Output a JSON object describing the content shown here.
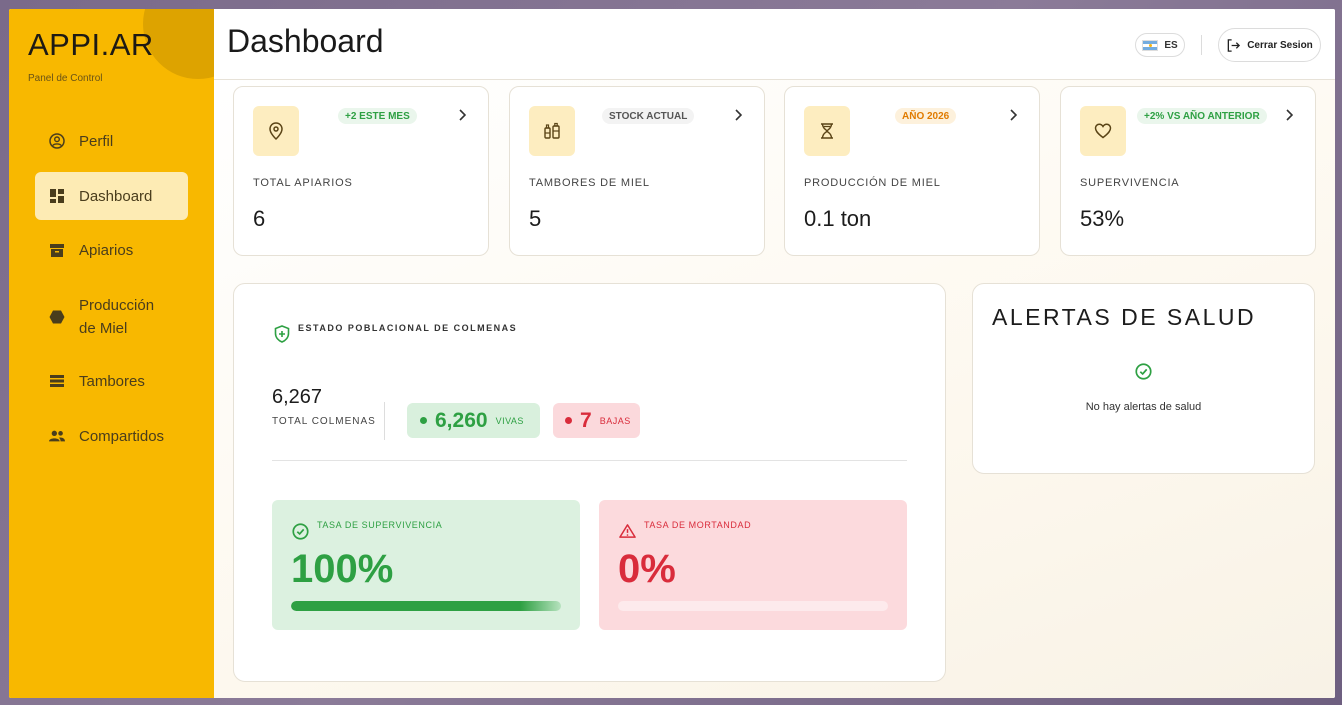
{
  "sidebar": {
    "brand": "APPI.AR",
    "subtitle": "Panel de Control",
    "items": [
      {
        "label": "Perfil",
        "icon": "user-circle-icon"
      },
      {
        "label": "Dashboard",
        "icon": "dashboard-icon",
        "active": true
      },
      {
        "label": "Apiarios",
        "icon": "archive-box-icon"
      },
      {
        "label": "Producción de Miel",
        "icon": "hexagon-icon"
      },
      {
        "label": "Tambores",
        "icon": "list-icon"
      },
      {
        "label": "Compartidos",
        "icon": "people-icon"
      }
    ]
  },
  "header": {
    "title": "Dashboard",
    "lang": "ES",
    "logout_label": "Cerrar Sesion"
  },
  "stats": [
    {
      "badge": "+2 ESTE MES",
      "label": "TOTAL APIARIOS",
      "value": "6",
      "icon": "location-pin-icon"
    },
    {
      "badge": "STOCK ACTUAL",
      "label": "TAMBORES DE MIEL",
      "value": "5",
      "icon": "bottles-icon"
    },
    {
      "badge": "AÑO 2026",
      "label": "PRODUCCIÓN DE MIEL",
      "value": "0.1 ton",
      "icon": "hourglass-icon"
    },
    {
      "badge": "+2% VS AÑO ANTERIOR",
      "label": "SUPERVIVENCIA",
      "value": "53%",
      "icon": "heart-icon"
    }
  ],
  "population": {
    "title": "ESTADO POBLACIONAL DE COLMENAS",
    "total_value": "6,267",
    "total_label": "TOTAL COLMENAS",
    "alive_value": "6,260",
    "alive_label": "VIVAS",
    "dead_value": "7",
    "dead_label": "BAJAS",
    "survival_label": "TASA DE SUPERVIVENCIA",
    "survival_value": "100%",
    "survival_fraction": 1.0,
    "mortality_label": "TASA DE MORTANDAD",
    "mortality_value": "0%",
    "mortality_fraction": 0.0
  },
  "alerts": {
    "title": "ALERTAS DE SALUD",
    "empty_text": "No hay alertas de salud"
  },
  "colors": {
    "sidebar": "#f8b800",
    "active_item": "#fdebb4",
    "green": "#2ea043",
    "red": "#d92c3b",
    "orange_badge": "#e07b00"
  }
}
